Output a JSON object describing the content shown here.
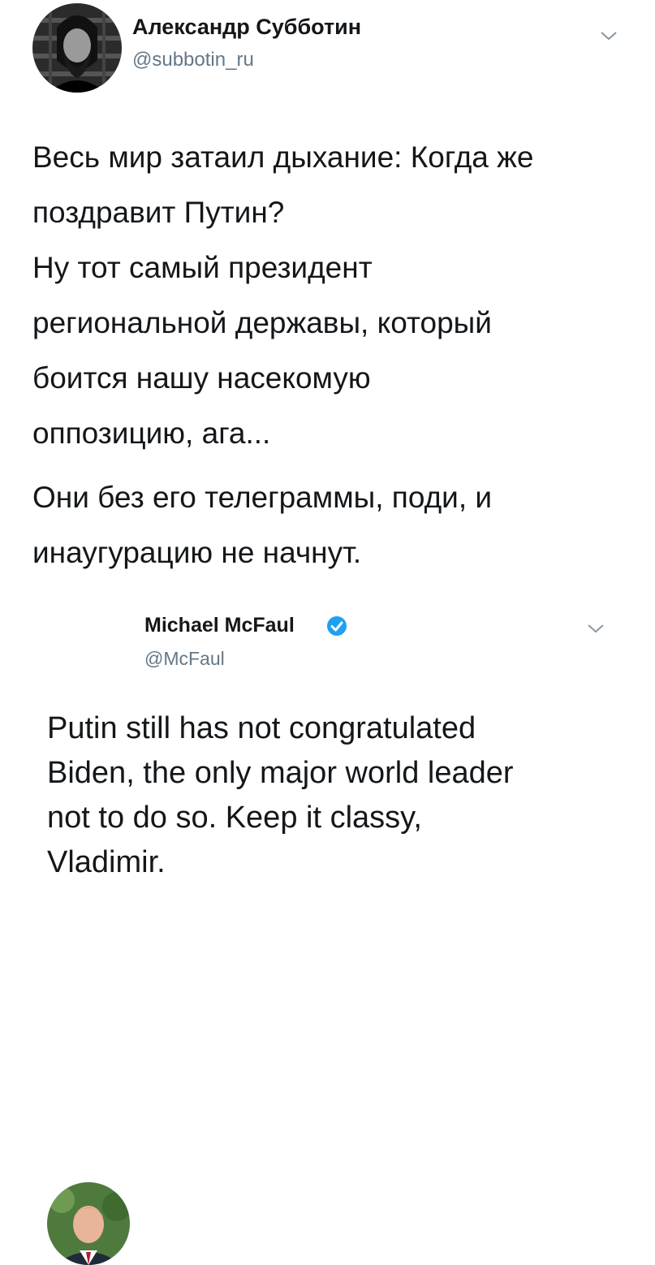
{
  "outer_tweet": {
    "author_name": "Александр Субботин",
    "handle": "@subbotin_ru",
    "paragraphs": [
      [
        "Весь мир затаил дыхание: Когда же",
        "поздравит Путин?",
        "Ну тот самый президент",
        "региональной державы, который",
        "боится нашу насекомую",
        "оппозицию, ага..."
      ],
      [
        "Они без его телеграммы, поди, и",
        "инаугурацию не начнут."
      ]
    ]
  },
  "quoted_tweet": {
    "author_name": "Michael McFaul",
    "handle": "@McFaul",
    "verified": true,
    "lines": [
      "Putin still has not congratulated",
      "Biden, the only major world leader",
      "not to do so. Keep it classy,",
      "Vladimir."
    ]
  },
  "icons": {
    "menu": "chevron-down-icon",
    "verified": "verified-badge-icon"
  },
  "colors": {
    "text": "#14171a",
    "secondary": "#657786",
    "verified": "#1da1f2"
  }
}
